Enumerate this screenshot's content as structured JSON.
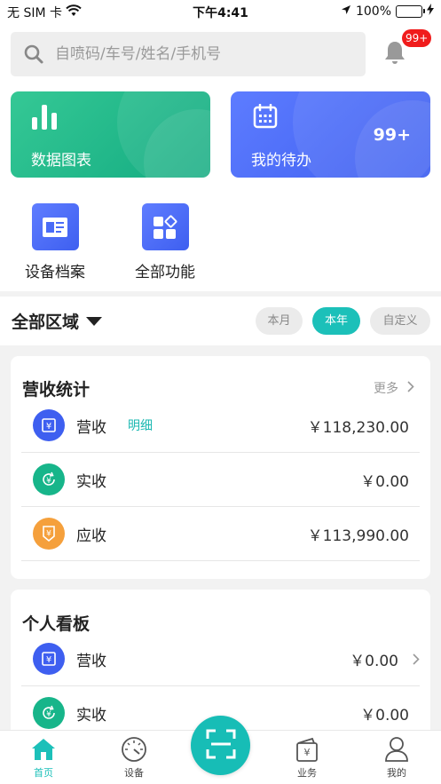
{
  "status_bar": {
    "carrier": "无 SIM 卡",
    "time": "下午4:41",
    "battery_pct": "100%",
    "battery_level": 1.0
  },
  "search": {
    "placeholder": "自喷码/车号/姓名/手机号",
    "value": ""
  },
  "notifications": {
    "badge": "99+"
  },
  "cards": {
    "charts_label": "数据图表",
    "todo_label": "我的待办",
    "todo_count": "99+"
  },
  "quick_actions": [
    {
      "label": "设备档案",
      "icon": "archive-icon"
    },
    {
      "label": "全部功能",
      "icon": "apps-grid-icon"
    }
  ],
  "filter": {
    "region": "全部区域",
    "periods": [
      {
        "label": "本月",
        "active": false
      },
      {
        "label": "本年",
        "active": true
      },
      {
        "label": "自定义",
        "active": false
      }
    ]
  },
  "revenue": {
    "title": "营收统计",
    "more": "更多",
    "rows": [
      {
        "name": "营收",
        "link": "明细",
        "value": "￥118,230.00",
        "color": "#3e5ff0"
      },
      {
        "name": "实收",
        "value": "￥0.00",
        "color": "#17b58a"
      },
      {
        "name": "应收",
        "value": "￥113,990.00",
        "color": "#f5a03c"
      }
    ]
  },
  "personal": {
    "title": "个人看板",
    "rows": [
      {
        "name": "营收",
        "value": "￥0.00",
        "color": "#3e5ff0"
      },
      {
        "name": "实收",
        "value": "￥0.00",
        "color": "#17b58a"
      }
    ]
  },
  "tabbar": {
    "tabs": [
      {
        "label": "首页",
        "active": true
      },
      {
        "label": "设备",
        "active": false
      },
      {
        "label": "业务",
        "active": false
      },
      {
        "label": "我的",
        "active": false
      }
    ]
  },
  "colors": {
    "accent": "#1cc0b9",
    "green_card": "#1fb487",
    "blue_card": "#4a6cf7",
    "badge": "#f01c1c"
  }
}
